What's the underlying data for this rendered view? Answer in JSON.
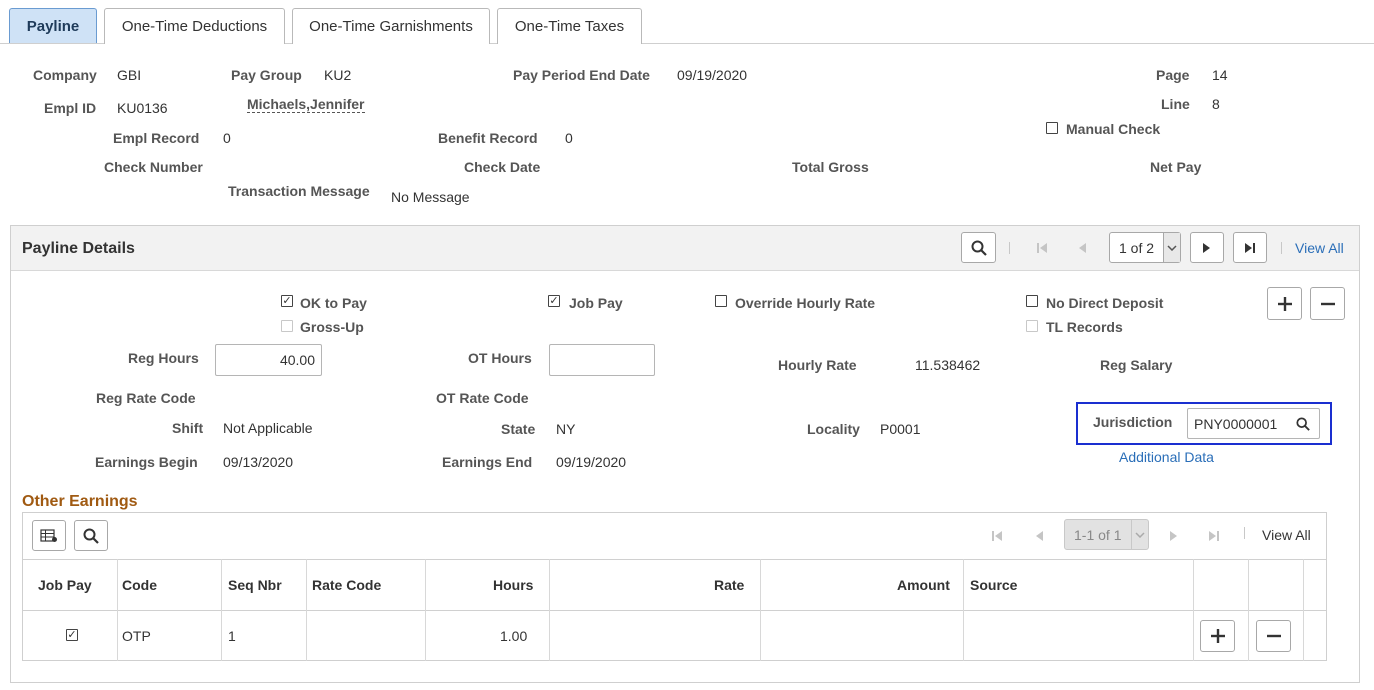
{
  "tabs": [
    "Payline",
    "One-Time Deductions",
    "One-Time Garnishments",
    "One-Time Taxes"
  ],
  "header": {
    "company_label": "Company",
    "company": "GBI",
    "pay_group_label": "Pay Group",
    "pay_group": "KU2",
    "pay_period_end_label": "Pay Period End Date",
    "pay_period_end": "09/19/2020",
    "page_label": "Page",
    "page": "14",
    "empl_id_label": "Empl ID",
    "empl_id": "KU0136",
    "name": "Michaels,Jennifer",
    "line_label": "Line",
    "line": "8",
    "manual_check_label": "Manual Check",
    "empl_record_label": "Empl Record",
    "empl_record": "0",
    "benefit_record_label": "Benefit Record",
    "benefit_record": "0",
    "check_number_label": "Check Number",
    "check_date_label": "Check Date",
    "total_gross_label": "Total Gross",
    "net_pay_label": "Net Pay",
    "transaction_message_label": "Transaction Message",
    "transaction_message": "No Message"
  },
  "details": {
    "title": "Payline Details",
    "pager": "1 of 2",
    "view_all": "View All",
    "ok_to_pay": "OK to Pay",
    "gross_up": "Gross-Up",
    "job_pay": "Job Pay",
    "override_hourly_rate": "Override Hourly Rate",
    "no_direct_deposit": "No Direct Deposit",
    "tl_records": "TL Records",
    "reg_hours_label": "Reg Hours",
    "reg_hours": "40.00",
    "ot_hours_label": "OT Hours",
    "ot_hours": "",
    "hourly_rate_label": "Hourly Rate",
    "hourly_rate": "11.538462",
    "reg_salary_label": "Reg Salary",
    "reg_rate_code_label": "Reg Rate Code",
    "ot_rate_code_label": "OT Rate Code",
    "shift_label": "Shift",
    "shift": "Not Applicable",
    "state_label": "State",
    "state": "NY",
    "locality_label": "Locality",
    "locality": "P0001",
    "jurisdiction_label": "Jurisdiction",
    "jurisdiction": "PNY0000001",
    "additional_data": "Additional Data",
    "earnings_begin_label": "Earnings Begin",
    "earnings_begin": "09/13/2020",
    "earnings_end_label": "Earnings End",
    "earnings_end": "09/19/2020"
  },
  "other_earnings": {
    "title": "Other Earnings",
    "pager": "1-1 of 1",
    "view_all": "View All",
    "columns": [
      "Job Pay",
      "Code",
      "Seq Nbr",
      "Rate Code",
      "Hours",
      "Rate",
      "Amount",
      "Source"
    ],
    "row": {
      "job_pay": "☑",
      "code": "OTP",
      "seq_nbr": "1",
      "rate_code": "",
      "hours": "1.00",
      "rate": "",
      "amount": "",
      "source": ""
    }
  },
  "icons": {
    "search": "magnifier",
    "first": "first-page",
    "prev": "previous",
    "next": "next",
    "last": "last-page",
    "dropdown": "chevron-down",
    "add": "plus",
    "delete": "minus",
    "personalize": "grid-settings"
  },
  "colors": {
    "link": "#2a6eb8",
    "section_title": "#a05a12",
    "active_tab": "#cfe2f6",
    "focus_border": "#1a2fd0"
  }
}
